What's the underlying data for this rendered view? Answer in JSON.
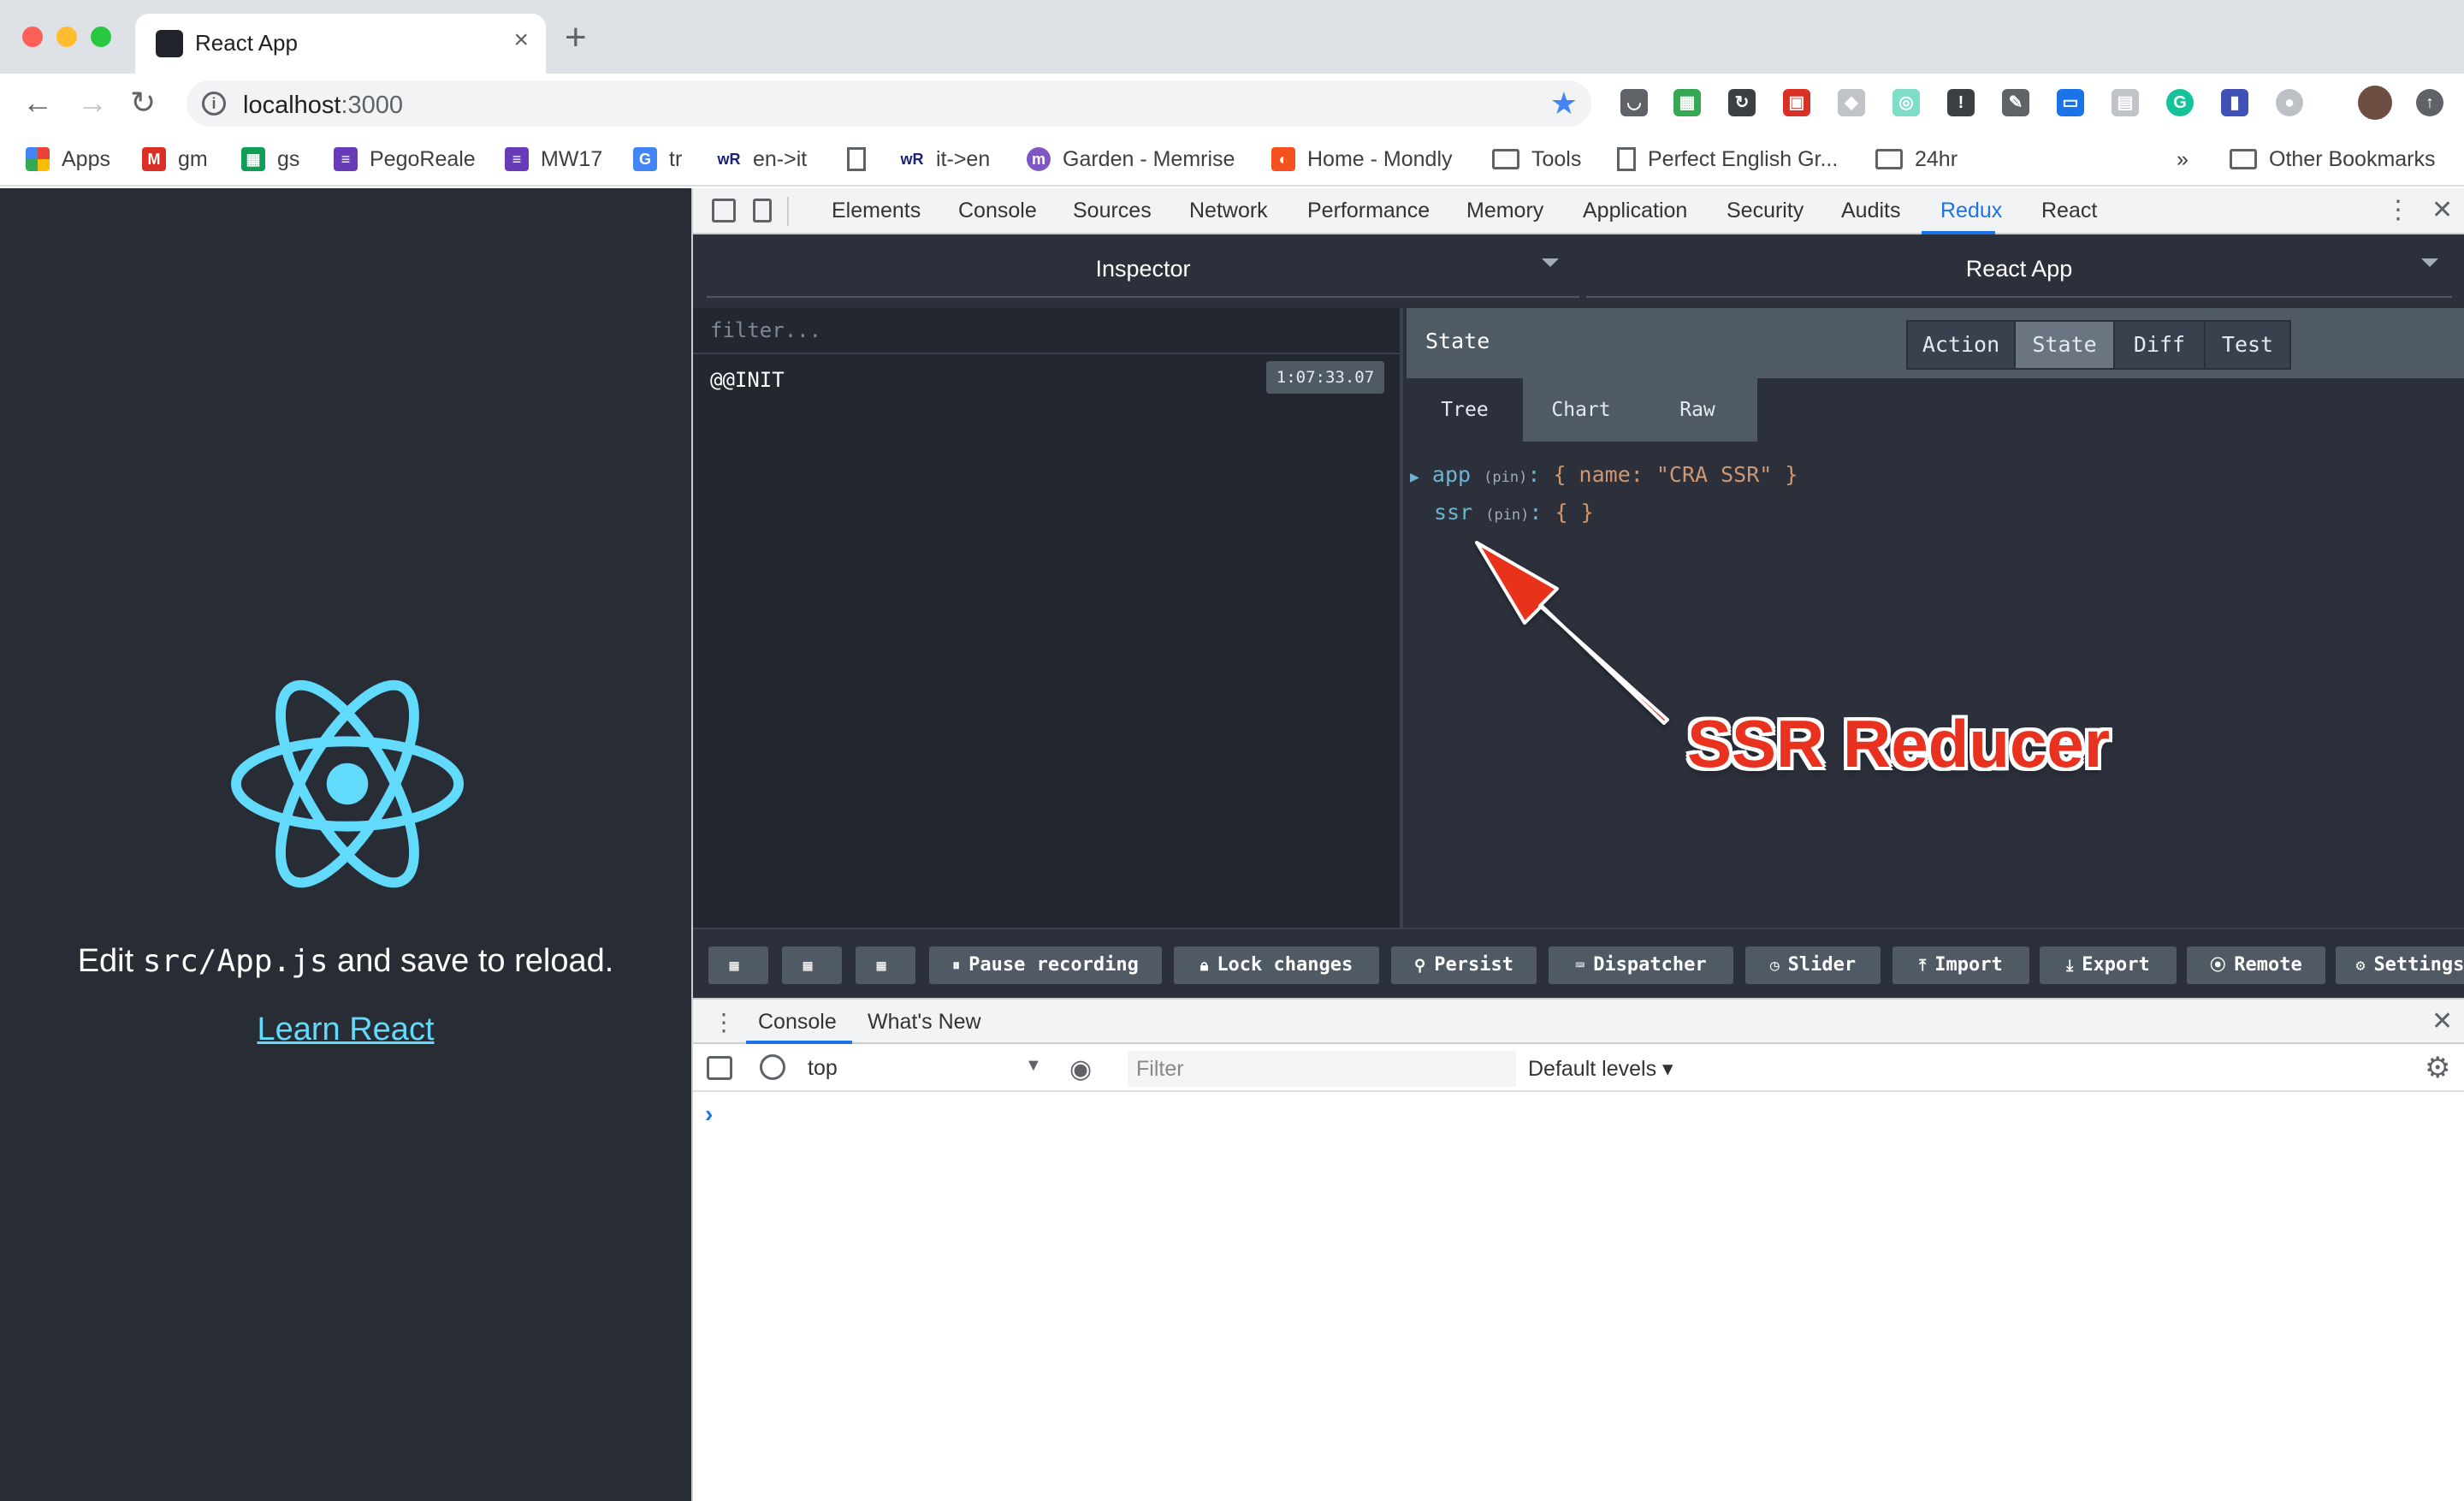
{
  "browser": {
    "tab_title": "React App",
    "url_host": "localhost",
    "url_port": ":3000",
    "bookmarks": [
      "Apps",
      "gm",
      "gs",
      "PegoReale",
      "MW17",
      "tr",
      "en->it",
      "it->en",
      "Garden - Memrise",
      "Home - Mondly",
      "Tools",
      "Perfect English Gr...",
      "24hr"
    ],
    "bookmarks_overflow": "»",
    "other_bookmarks": "Other Bookmarks"
  },
  "page": {
    "edit_prefix": "Edit ",
    "edit_code": "src/App.js",
    "edit_suffix": " and save to reload.",
    "link": "Learn React",
    "logo_color": "#61dafb",
    "background": "#282c34"
  },
  "devtools": {
    "tabs": [
      "Elements",
      "Console",
      "Sources",
      "Network",
      "Performance",
      "Memory",
      "Application",
      "Security",
      "Audits",
      "Redux",
      "React"
    ],
    "active_tab": "Redux"
  },
  "redux": {
    "monitor_select": "Inspector",
    "instance_select": "React App",
    "filter_placeholder": "filter...",
    "actions": [
      {
        "name": "@@INIT",
        "time": "1:07:33.07"
      }
    ],
    "panel_title": "State",
    "segments": [
      "Action",
      "State",
      "Diff",
      "Test"
    ],
    "active_segment": "State",
    "subtabs": [
      "Tree",
      "Chart",
      "Raw"
    ],
    "active_subtab": "Tree",
    "tree": [
      {
        "arrow": "▶",
        "key": "app",
        "pin": "(pin)",
        "sep": ":",
        "value": "{ name: \"CRA SSR\" }"
      },
      {
        "arrow": "",
        "key": "ssr",
        "pin": "(pin)",
        "sep": ":",
        "value": "{ }"
      }
    ],
    "bottom_buttons": [
      "Pause recording",
      "Lock changes",
      "Persist",
      "Dispatcher",
      "Slider",
      "Import",
      "Export",
      "Remote",
      "Settings"
    ]
  },
  "console": {
    "tabs": [
      "Console",
      "What's New"
    ],
    "context": "top",
    "filter_placeholder": "Filter",
    "levels": "Default levels ▾",
    "prompt": "›"
  },
  "annotation": {
    "text": "SSR Reducer",
    "color": "#e8321f"
  }
}
